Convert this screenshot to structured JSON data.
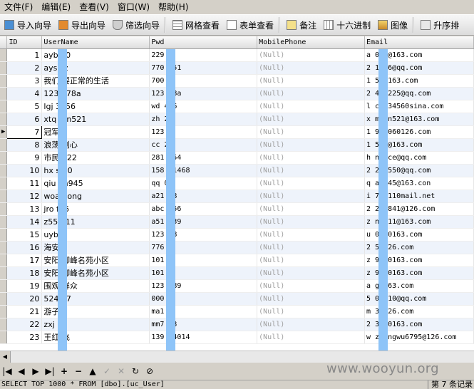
{
  "menu": [
    "文件(F)",
    "编辑(E)",
    "查看(V)",
    "窗口(W)",
    "帮助(H)"
  ],
  "toolbar": {
    "import": "导入向导",
    "export": "导出向导",
    "filter": "筛选向导",
    "grid_view": "网格查看",
    "form_view": "表单查看",
    "memo": "备注",
    "hex": "十六进制",
    "image": "图像",
    "sort": "升序排"
  },
  "columns": [
    "ID",
    "UserName",
    "Pwd",
    "MobilePhone",
    "Email"
  ],
  "rows": [
    {
      "id": "1",
      "username": "ayb   00",
      "pwd": "229",
      "mobile": "(Null)",
      "email": "a    000@163.com"
    },
    {
      "id": "2",
      "username": "ays   zz",
      "pwd": "770   151",
      "mobile": "(Null)",
      "email": "2    1686@qq.com"
    },
    {
      "id": "3",
      "username": "我们  要正常的生活",
      "pwd": "700",
      "mobile": "(Null)",
      "email": "1    56@163.com"
    },
    {
      "id": "4",
      "username": "123   678a",
      "pwd": "123   78a",
      "mobile": "(Null)",
      "email": "2    491225@qq.com"
    },
    {
      "id": "5",
      "username": "lgj   3456",
      "pwd": "wd    456",
      "mobile": "(Null)",
      "email": "l    c1234560sina.com"
    },
    {
      "id": "6",
      "username": "xtq   ofn521",
      "pwd": "zh    21",
      "mobile": "(Null)",
      "email": "x    mofn521@163.com"
    },
    {
      "id": "7",
      "username": "冠军",
      "pwd": "123",
      "mobile": "(Null)",
      "email": "1    904060126.com"
    },
    {
      "id": "8",
      "username": "浪荡  刺心",
      "pwd": "cc    22",
      "mobile": "(Null)",
      "email": "1    520@163.com"
    },
    {
      "id": "9",
      "username": "市民  122",
      "pwd": "281   854",
      "mobile": "(Null)",
      "email": "h    ndice@qq.com"
    },
    {
      "id": "10",
      "username": "hx s   10",
      "pwd": "158   61468",
      "mobile": "(Null)",
      "email": "2    261550@qq.com"
    },
    {
      "id": "11",
      "username": "qiu   an945",
      "pwd": "qq    00",
      "mobile": "(Null)",
      "email": "q    an945@163.con"
    },
    {
      "id": "12",
      "username": "woa   hong",
      "pwd": "a21   88",
      "mobile": "(Null)",
      "email": "i    71@110mail.net"
    },
    {
      "id": "13",
      "username": "jro   f96",
      "pwd": "abc   456",
      "mobile": "(Null)",
      "email": "2    296841@126.com"
    },
    {
      "id": "14",
      "username": "z55   611",
      "pwd": "a51   039",
      "mobile": "(Null)",
      "email": "z    na111@163.com"
    },
    {
      "id": "15",
      "username": "uyb   6",
      "pwd": "123   78",
      "mobile": "(Null)",
      "email": "u    0160163.com"
    },
    {
      "id": "16",
      "username": "海安",
      "pwd": "776",
      "mobile": "(Null)",
      "email": "2    5@126.com"
    },
    {
      "id": "17",
      "username": "安阳  御峰名苑小区",
      "pwd": "101",
      "mobile": "(Null)",
      "email": "z    9660163.com"
    },
    {
      "id": "18",
      "username": "安阳  御峰名苑小区",
      "pwd": "101",
      "mobile": "(Null)",
      "email": "z    9660163.com"
    },
    {
      "id": "19",
      "username": "围观  群众",
      "pwd": "123   789",
      "mobile": "(Null)",
      "email": "a    g@163.com"
    },
    {
      "id": "20",
      "username": "524   27",
      "pwd": "000",
      "mobile": "(Null)",
      "email": "5    08210@qq.com"
    },
    {
      "id": "21",
      "username": "游子",
      "pwd": "ma1",
      "mobile": "(Null)",
      "email": "m    3@126.com"
    },
    {
      "id": "22",
      "username": "zxj   72",
      "pwd": "mm7   03",
      "mobile": "(Null)",
      "email": "2    3720163.com"
    },
    {
      "id": "23",
      "username": "王红  飞",
      "pwd": "139   24014",
      "mobile": "(Null)",
      "email": "w    zhongwu6795@126.com"
    }
  ],
  "selected_row_id": "7",
  "colors": {
    "redaction": "#8ec4f8",
    "alt_row": "#eef3fb",
    "null_text": "#a0a0a0"
  },
  "nav_icons": [
    "first-icon",
    "prev-icon",
    "next-icon",
    "last-icon",
    "add-icon",
    "delete-icon",
    "up-icon",
    "confirm-icon",
    "cancel-icon",
    "refresh-icon",
    "stop-icon"
  ],
  "watermark": "www.wooyun.org",
  "status": {
    "sql": "SELECT TOP 1000  * FROM [dbo].[uc_User]",
    "record": "第 7 条记录"
  }
}
